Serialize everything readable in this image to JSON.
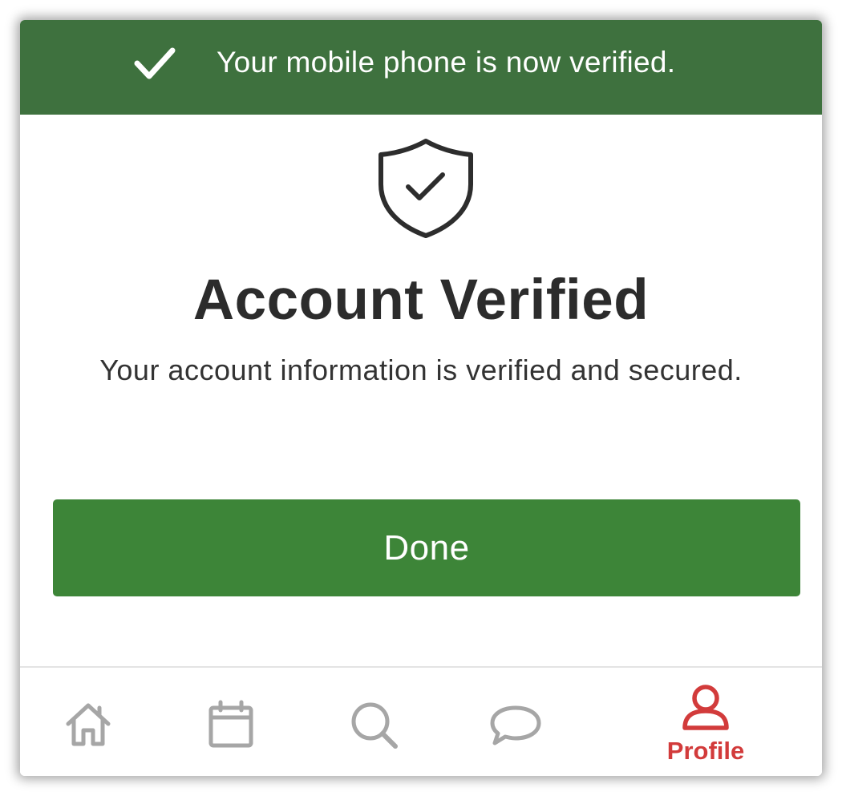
{
  "banner": {
    "message": "Your mobile phone is now verified.",
    "icon": "check-icon",
    "background_color": "#3e713e"
  },
  "main": {
    "icon": "shield-check-icon",
    "title": "Account Verified",
    "subtitle": "Your account information is verified and secured."
  },
  "actions": {
    "done_label": "Done",
    "done_color": "#3d8538"
  },
  "tabbar": {
    "items": [
      {
        "icon": "home-icon",
        "label": "",
        "active": false
      },
      {
        "icon": "calendar-icon",
        "label": "",
        "active": false
      },
      {
        "icon": "search-icon",
        "label": "",
        "active": false
      },
      {
        "icon": "chat-bubble-icon",
        "label": "",
        "active": false
      },
      {
        "icon": "profile-icon",
        "label": "Profile",
        "active": true
      }
    ],
    "inactive_color": "#a6a6a6",
    "active_color": "#d23b3b"
  }
}
